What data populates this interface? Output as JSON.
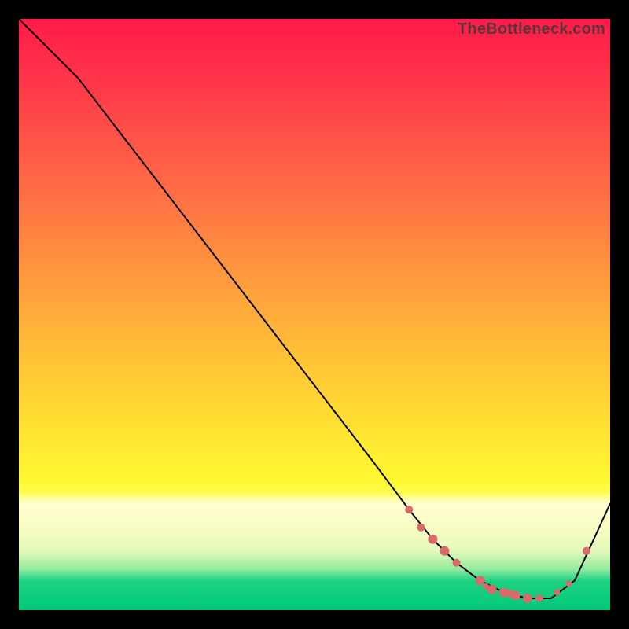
{
  "watermark": "TheBottleneck.com",
  "colors": {
    "curve": "#000000",
    "marker": "#d96a6a",
    "marker_stroke": "#c94f4f"
  },
  "chart_data": {
    "type": "line",
    "title": "",
    "xlabel": "",
    "ylabel": "",
    "xlim": [
      0,
      100
    ],
    "ylim": [
      0,
      100
    ],
    "grid": false,
    "legend": false,
    "series": [
      {
        "name": "bottleneck-curve",
        "x": [
          0,
          6,
          10,
          20,
          30,
          40,
          50,
          60,
          66,
          70,
          74,
          78,
          82,
          86,
          90,
          94,
          100
        ],
        "y": [
          100,
          94,
          90,
          77,
          64,
          51,
          38,
          25,
          17,
          12,
          8,
          5,
          3,
          2,
          2,
          5,
          18
        ]
      }
    ],
    "markers": [
      {
        "x": 66,
        "y": 17,
        "r": 5
      },
      {
        "x": 68,
        "y": 14,
        "r": 5
      },
      {
        "x": 70,
        "y": 12,
        "r": 6
      },
      {
        "x": 72,
        "y": 10,
        "r": 6
      },
      {
        "x": 74,
        "y": 8,
        "r": 5
      },
      {
        "x": 78,
        "y": 5,
        "r": 6
      },
      {
        "x": 79,
        "y": 4,
        "r": 4
      },
      {
        "x": 80,
        "y": 3.5,
        "r": 6
      },
      {
        "x": 82,
        "y": 3,
        "r": 6
      },
      {
        "x": 83,
        "y": 2.8,
        "r": 5
      },
      {
        "x": 84,
        "y": 2.5,
        "r": 6
      },
      {
        "x": 86,
        "y": 2,
        "r": 6
      },
      {
        "x": 88,
        "y": 2,
        "r": 5
      },
      {
        "x": 91,
        "y": 3,
        "r": 4
      },
      {
        "x": 93,
        "y": 4.5,
        "r": 4
      },
      {
        "x": 96,
        "y": 10,
        "r": 5
      }
    ]
  }
}
